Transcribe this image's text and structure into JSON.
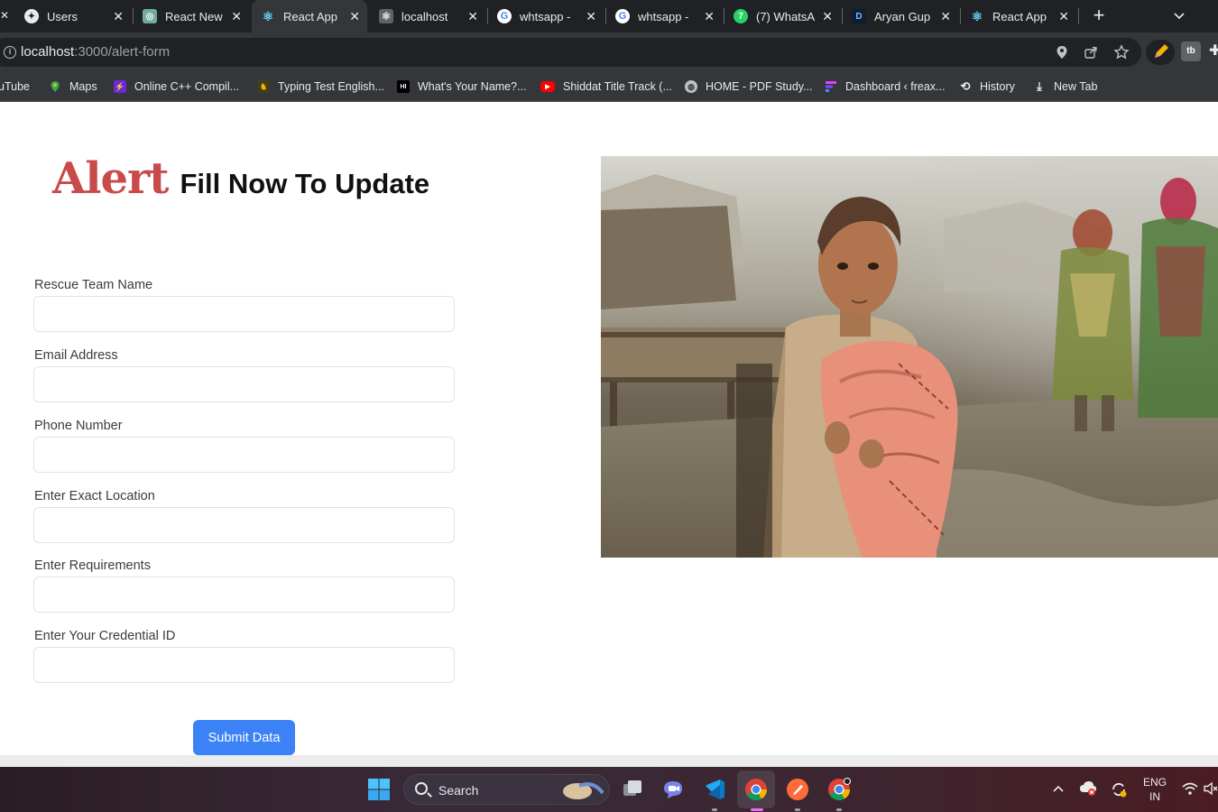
{
  "browser": {
    "tabs": [
      {
        "label": "Users",
        "icon": "shield-icon",
        "active": false
      },
      {
        "label": "React New",
        "icon": "chatgpt-icon",
        "active": false
      },
      {
        "label": "React App",
        "icon": "react-icon",
        "active": true
      },
      {
        "label": "localhost",
        "icon": "react-icon",
        "active": false
      },
      {
        "label": "whtsapp -",
        "icon": "google-icon",
        "active": false
      },
      {
        "label": "whtsapp -",
        "icon": "google-icon",
        "active": false
      },
      {
        "label": "(7) WhatsA",
        "icon": "whatsapp-icon",
        "active": false
      },
      {
        "label": "Aryan Gup",
        "icon": "d-icon",
        "active": false
      },
      {
        "label": "React App",
        "icon": "react-icon",
        "active": false
      }
    ],
    "address": {
      "host": "localhost",
      "path": ":3000/alert-form"
    },
    "bookmarks": [
      {
        "label": "uTube",
        "icon": "youtube-icon"
      },
      {
        "label": "Maps",
        "icon": "maps-icon"
      },
      {
        "label": "Online C++ Compil...",
        "icon": "bolt-icon"
      },
      {
        "label": "Typing Test English...",
        "icon": "typing-icon"
      },
      {
        "label": "What's Your Name?...",
        "icon": "hi-icon"
      },
      {
        "label": "Shiddat Title Track (...",
        "icon": "youtube-icon"
      },
      {
        "label": "HOME - PDF Study...",
        "icon": "globe-icon"
      },
      {
        "label": "Dashboard ‹ freax...",
        "icon": "dashboard-icon"
      },
      {
        "label": "History",
        "icon": "history-icon"
      },
      {
        "label": "New Tab",
        "icon": "download-icon"
      }
    ]
  },
  "form": {
    "heading_accent": "Alert",
    "heading_rest": "Fill Now To Update",
    "fields": [
      {
        "label": "Rescue Team Name",
        "value": ""
      },
      {
        "label": "Email Address",
        "value": ""
      },
      {
        "label": "Phone Number",
        "value": ""
      },
      {
        "label": "Enter Exact Location",
        "value": ""
      },
      {
        "label": "Enter Requirements",
        "value": ""
      },
      {
        "label": "Enter Your Credential ID",
        "value": ""
      }
    ],
    "submit_label": "Submit Data"
  },
  "taskbar": {
    "search_label": "Search",
    "lang_line1": "ENG",
    "lang_line2": "IN"
  },
  "colors": {
    "accent_red": "#c94a4a",
    "button_blue": "#3b82f6"
  }
}
